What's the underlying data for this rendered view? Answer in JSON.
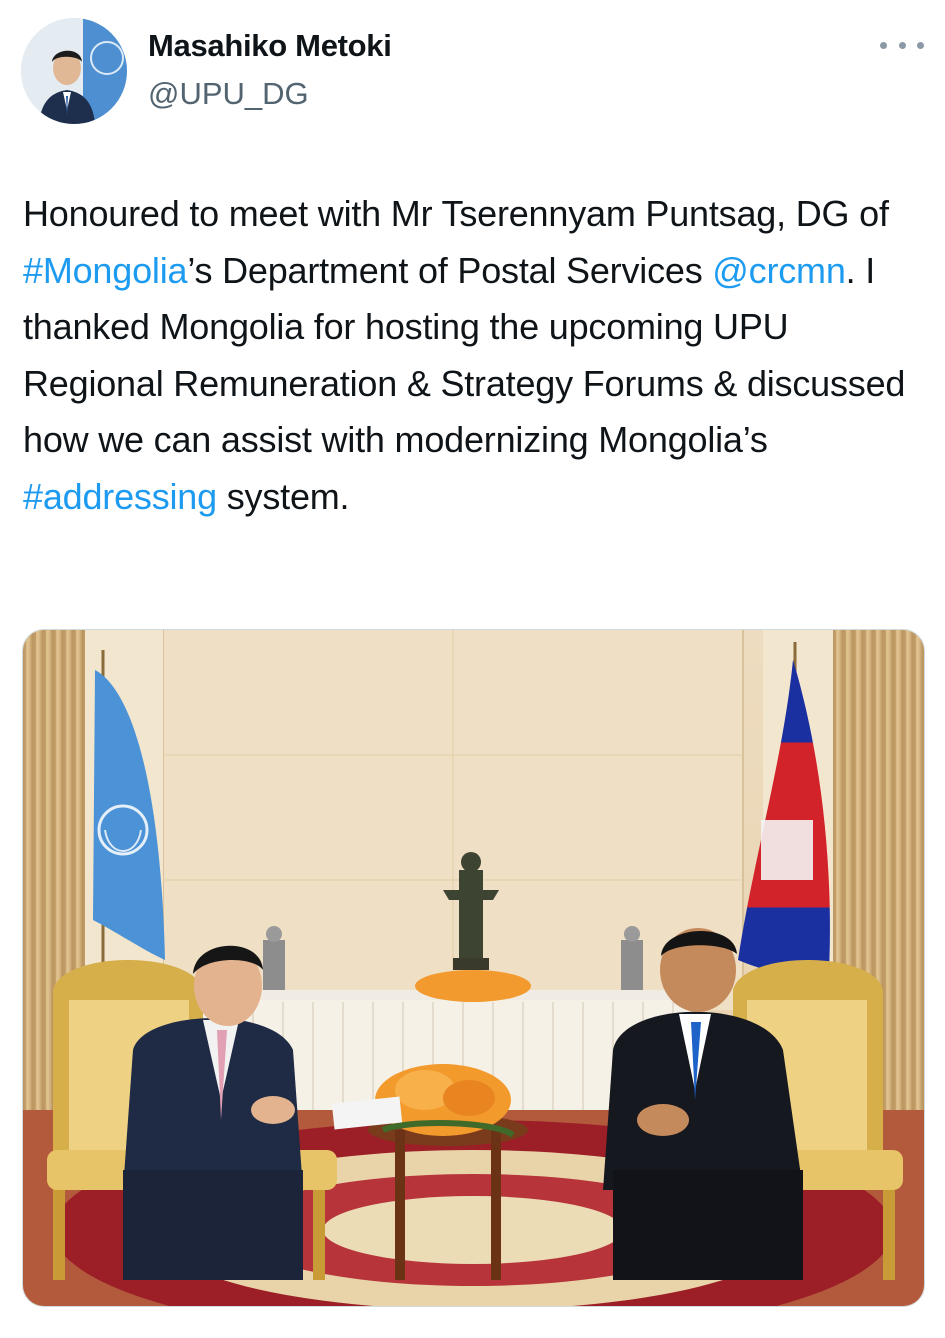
{
  "author": {
    "display_name": "Masahiko Metoki",
    "handle": "@UPU_DG",
    "avatar_icon": "profile-photo"
  },
  "menu": {
    "icon": "more-options-icon"
  },
  "tweet": {
    "segments": [
      {
        "text": "Honoured to meet with Mr Tserennyam Puntsag, DG of ",
        "type": "text"
      },
      {
        "text": "#Mongolia",
        "type": "hashtag"
      },
      {
        "text": "’s Department of Postal Services ",
        "type": "text"
      },
      {
        "text": "@crcmn",
        "type": "mention"
      },
      {
        "text": ". I thanked Mongolia for hosting the upcoming UPU Regional Remuneration & Strategy Forums & discussed how we can assist with modernizing Mongolia’s ",
        "type": "text"
      },
      {
        "text": "#addressing",
        "type": "hashtag"
      },
      {
        "text": " system.",
        "type": "text"
      }
    ]
  },
  "colors": {
    "link": "#1d9bf0",
    "text": "#0f1419",
    "secondary": "#536471"
  }
}
